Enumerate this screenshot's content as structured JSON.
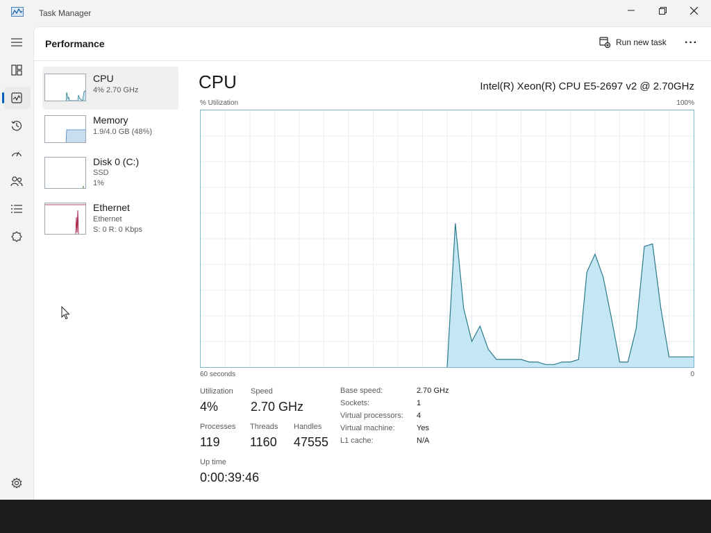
{
  "app": {
    "title": "Task Manager"
  },
  "header": {
    "title": "Performance",
    "run_new_task": "Run new task",
    "more": "···"
  },
  "nav": {
    "items": [
      {
        "name": "hamburger",
        "icon": "menu-icon"
      },
      {
        "name": "processes",
        "icon": "processes-icon"
      },
      {
        "name": "performance",
        "icon": "performance-icon",
        "active": true
      },
      {
        "name": "app-history",
        "icon": "history-icon"
      },
      {
        "name": "startup-apps",
        "icon": "startup-icon"
      },
      {
        "name": "users",
        "icon": "users-icon"
      },
      {
        "name": "details",
        "icon": "details-icon"
      },
      {
        "name": "services",
        "icon": "services-icon"
      },
      {
        "name": "settings",
        "icon": "gear-icon"
      }
    ]
  },
  "sidebar": {
    "items": [
      {
        "name": "CPU",
        "line1": "4%  2.70 GHz",
        "line2": ""
      },
      {
        "name": "Memory",
        "line1": "1.9/4.0 GB (48%)",
        "line2": ""
      },
      {
        "name": "Disk 0 (C:)",
        "line1": "SSD",
        "line2": "1%"
      },
      {
        "name": "Ethernet",
        "line1": "Ethernet",
        "line2": "S: 0  R: 0 Kbps"
      }
    ]
  },
  "main": {
    "title": "CPU",
    "model": "Intel(R) Xeon(R) CPU E5-2697 v2 @ 2.70GHz",
    "y_axis_label": "% Utilization",
    "y_max_label": "100%",
    "x_left_label": "60 seconds",
    "x_right_label": "0"
  },
  "stats": {
    "utilization_label": "Utilization",
    "utilization_value": "4%",
    "speed_label": "Speed",
    "speed_value": "2.70 GHz",
    "processes_label": "Processes",
    "processes_value": "119",
    "threads_label": "Threads",
    "threads_value": "1160",
    "handles_label": "Handles",
    "handles_value": "47555",
    "uptime_label": "Up time",
    "uptime_value": "0:00:39:46"
  },
  "details": [
    {
      "key": "Base speed:",
      "value": "2.70 GHz"
    },
    {
      "key": "Sockets:",
      "value": "1"
    },
    {
      "key": "Virtual processors:",
      "value": "4"
    },
    {
      "key": "Virtual machine:",
      "value": "Yes"
    },
    {
      "key": "L1 cache:",
      "value": "N/A"
    }
  ],
  "colors": {
    "graph_fill": "#c4e7f3",
    "graph_line": "#2b7a8c",
    "graph_border": "#7eb6d1",
    "grid": "#e4eef3",
    "memory_fill": "#c9ddf0",
    "ethernet_line": "#a3123a"
  },
  "chart_data": {
    "type": "area",
    "x_label": "60 seconds",
    "y_label": "% Utilization",
    "ylim": [
      0,
      100
    ],
    "xlim": [
      60,
      0
    ],
    "grid": true,
    "series": [
      {
        "values_time_to_pct": [
          [
            30,
            0
          ],
          [
            29,
            56
          ],
          [
            28,
            23
          ],
          [
            27,
            10
          ],
          [
            26,
            16
          ],
          [
            25,
            7
          ],
          [
            24,
            3
          ],
          [
            23,
            3
          ],
          [
            22,
            3
          ],
          [
            21,
            3
          ],
          [
            20,
            2
          ],
          [
            19,
            2
          ],
          [
            18,
            1
          ],
          [
            17,
            1
          ],
          [
            16,
            2
          ],
          [
            15,
            2
          ],
          [
            14,
            3
          ],
          [
            13,
            37
          ],
          [
            12,
            44
          ],
          [
            11,
            35
          ],
          [
            10,
            19
          ],
          [
            9,
            2
          ],
          [
            8,
            2
          ],
          [
            7,
            15
          ],
          [
            6,
            47
          ],
          [
            5,
            48
          ],
          [
            4,
            23
          ],
          [
            3,
            4
          ],
          [
            0,
            4
          ]
        ]
      }
    ]
  }
}
